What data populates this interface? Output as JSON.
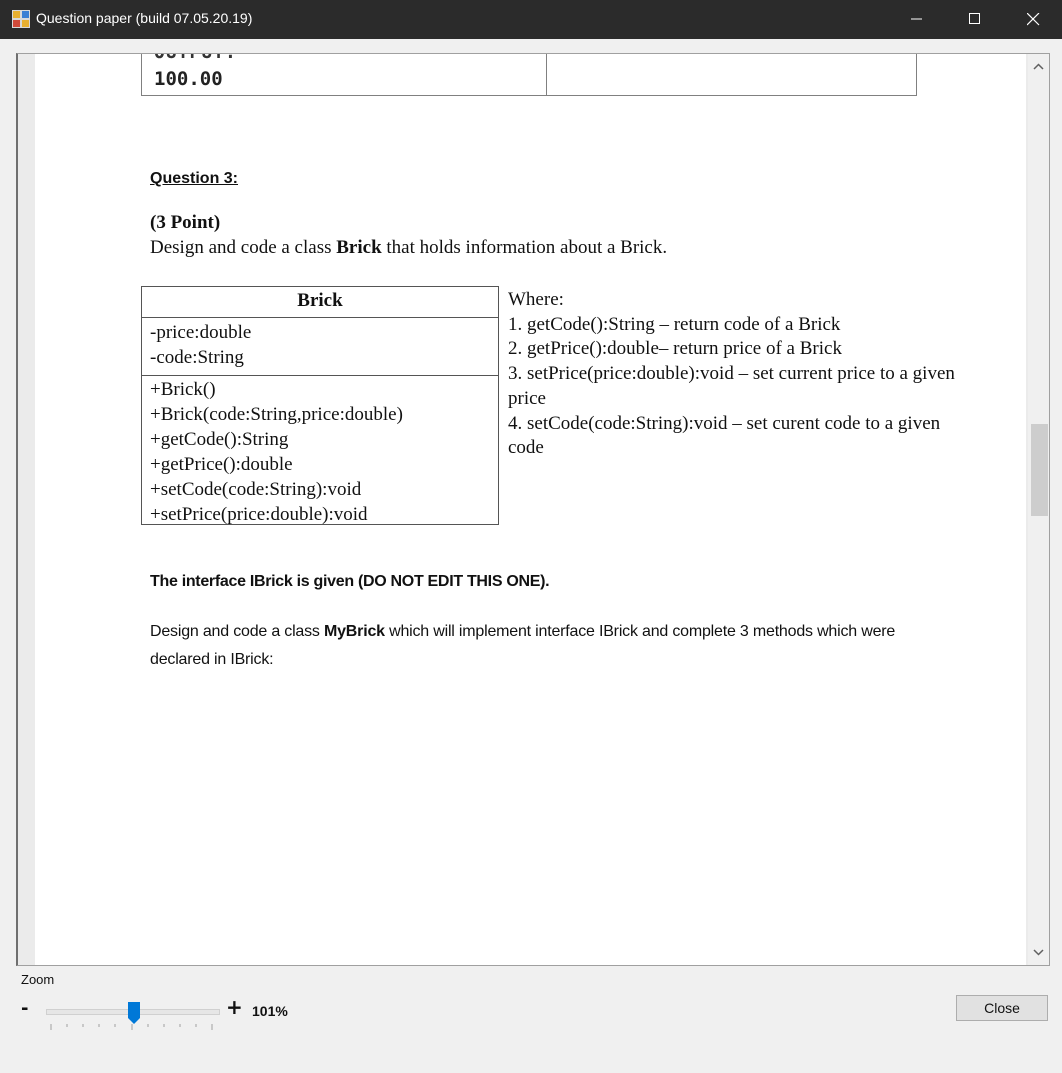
{
  "window": {
    "title": "Question paper (build 07.05.20.19)"
  },
  "document": {
    "cut_off_label": "OUTPUT:",
    "output_value": "100.00",
    "question_heading": "Question 3:",
    "points": "(3 Point)",
    "description_prefix": "Design and code a class ",
    "description_class": "Brick",
    "description_suffix": " that holds information about a Brick.",
    "uml": {
      "class_name": "Brick",
      "attributes": [
        "-price:double",
        "-code:String"
      ],
      "methods": [
        "+Brick()",
        "+Brick(code:String,price:double)",
        "+getCode():String",
        "+getPrice():double",
        "+setCode(code:String):void",
        "+setPrice(price:double):void"
      ]
    },
    "where": {
      "heading": "Where:",
      "items": [
        "1. getCode():String – return code of a Brick",
        "2. getPrice():double– return price of a Brick",
        "3. setPrice(price:double):void – set current price to a given price",
        "4. setCode(code:String):void – set curent code to a given code"
      ]
    },
    "interface_note": "The interface IBrick is given (DO NOT EDIT THIS ONE).",
    "design_prefix": "Design and code a class ",
    "design_class": "MyBrick",
    "design_suffix": " which will implement interface IBrick and complete 3 methods which were declared in IBrick:"
  },
  "footer": {
    "zoom_label": "Zoom",
    "zoom_minus": "-",
    "zoom_plus": "+",
    "zoom_value": "101%",
    "zoom_level_fraction": 0.5,
    "close_label": "Close"
  },
  "colors": {
    "titlebar_bg": "#2b2b2b",
    "accent": "#0078d7",
    "page_bg": "#ffffff",
    "window_bg": "#f0f0f0"
  }
}
